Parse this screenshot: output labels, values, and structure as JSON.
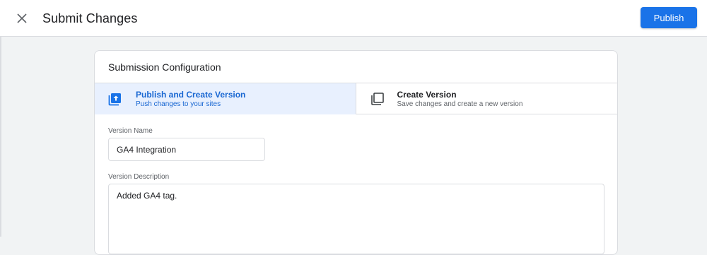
{
  "header": {
    "title": "Submit Changes",
    "publish_label": "Publish"
  },
  "icons": {
    "close": "close-icon",
    "publish_version": "upload-icon",
    "create_version": "copy-icon"
  },
  "colors": {
    "accent": "#1a73e8",
    "selected_bg": "#e8f0fe",
    "selected_text": "#1967d2"
  },
  "config": {
    "title": "Submission Configuration",
    "options": [
      {
        "title": "Publish and Create Version",
        "subtitle": "Push changes to your sites",
        "selected": true
      },
      {
        "title": "Create Version",
        "subtitle": "Save changes and create a new version",
        "selected": false
      }
    ],
    "version_name_label": "Version Name",
    "version_name_value": "GA4 Integration",
    "version_description_label": "Version Description",
    "version_description_value": "Added GA4 tag."
  }
}
